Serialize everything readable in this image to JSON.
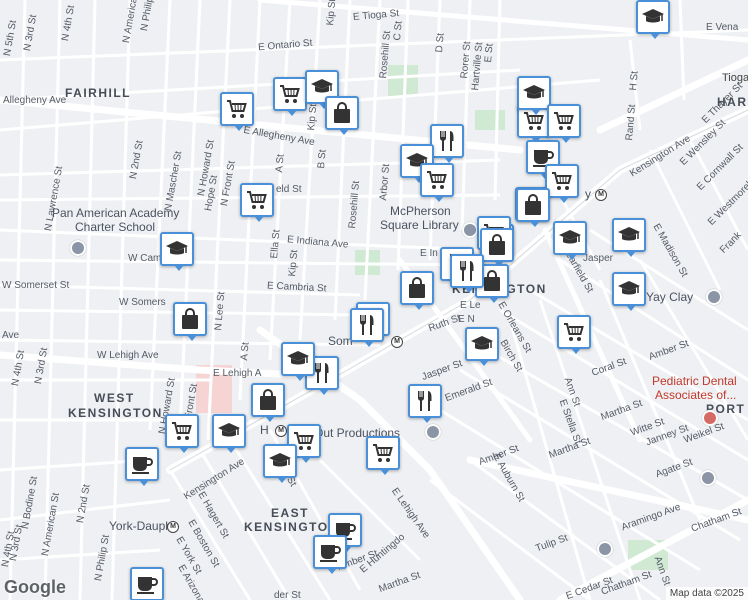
{
  "map": {
    "attribution": "Map data ©2025",
    "logo": "Google",
    "neighborhoods": [
      {
        "id": "fairhill",
        "text": "FAIRHILL"
      },
      {
        "id": "harrowgate",
        "text": "HARR"
      },
      {
        "id": "west-kensington-1",
        "text": "WEST"
      },
      {
        "id": "west-kensington-2",
        "text": "KENSINGTON"
      },
      {
        "id": "kensington",
        "text": "KENSINGTON"
      },
      {
        "id": "east-kensington-1",
        "text": "EAST"
      },
      {
        "id": "east-kensington-2",
        "text": "KENSINGTON"
      },
      {
        "id": "port",
        "text": "PORT"
      }
    ],
    "places": [
      {
        "id": "pan-american-1",
        "text": "Pan American Academy",
        "style": "place"
      },
      {
        "id": "pan-american-2",
        "text": "Charter School",
        "style": "place"
      },
      {
        "id": "mcpherson-1",
        "text": "McPherson",
        "style": "place"
      },
      {
        "id": "mcpherson-2",
        "text": "Square Library",
        "style": "place"
      },
      {
        "id": "yay-clay",
        "text": "Yay Clay",
        "style": "place"
      },
      {
        "id": "pediatric-1",
        "text": "Pediatric Dental",
        "style": "red"
      },
      {
        "id": "pediatric-2",
        "text": "Associates of...",
        "style": "red"
      },
      {
        "id": "out-productions",
        "text": "Out Productions",
        "style": "place"
      },
      {
        "id": "york-dauphin",
        "text": "York-Dauphi",
        "style": "place"
      },
      {
        "id": "somerset-station",
        "text": "Som",
        "style": "place"
      },
      {
        "id": "huntingdon-station",
        "text": "H",
        "style": "place"
      },
      {
        "id": "allegheny-station",
        "text": "y",
        "style": "place"
      },
      {
        "id": "tioga-label",
        "text": "Tioga",
        "style": "big"
      }
    ],
    "streets": [
      {
        "id": "n-5th",
        "text": "N 5th St"
      },
      {
        "id": "n-4th-top",
        "text": "N 4th St"
      },
      {
        "id": "n-3rd-top",
        "text": "N 3rd St"
      },
      {
        "id": "n-2nd-top",
        "text": "N 2nd St"
      },
      {
        "id": "n-american-top",
        "text": "N American St"
      },
      {
        "id": "n-philip-top",
        "text": "N Philip St"
      },
      {
        "id": "n-mascher",
        "text": "N Mascher St"
      },
      {
        "id": "n-howard-top",
        "text": "N Howard St"
      },
      {
        "id": "hope",
        "text": "Hope St"
      },
      {
        "id": "n-front-top",
        "text": "N Front St"
      },
      {
        "id": "n-lawrence",
        "text": "N Lawrence St"
      },
      {
        "id": "e-tioga",
        "text": "E Tioga St"
      },
      {
        "id": "e-ontario",
        "text": "E Ontario St"
      },
      {
        "id": "e-allegheny",
        "text": "E Allegheny Ave"
      },
      {
        "id": "w-allegheny",
        "text": "Allegheny Ave"
      },
      {
        "id": "e-indiana",
        "text": "E Indiana Ave"
      },
      {
        "id": "e-cambria",
        "text": "E Cambria St"
      },
      {
        "id": "w-cambria",
        "text": "W Cambria St"
      },
      {
        "id": "w-somerset",
        "text": "W Somerset St"
      },
      {
        "id": "w-somerset-2",
        "text": "W Somers"
      },
      {
        "id": "w-lehigh",
        "text": "W Lehigh Ave"
      },
      {
        "id": "e-lehigh",
        "text": "E Lehigh A"
      },
      {
        "id": "e-lehigh-2",
        "text": "E Lehigh Ave"
      },
      {
        "id": "w-ave-left",
        "text": "Ave"
      },
      {
        "id": "kensington-ave",
        "text": "Kensington Ave"
      },
      {
        "id": "kensington-ave-ne",
        "text": "Kensington Ave"
      },
      {
        "id": "rosehill-1",
        "text": "Rosehill St"
      },
      {
        "id": "rosehill-2",
        "text": "Rosehill St"
      },
      {
        "id": "arbor",
        "text": "Arbor St"
      },
      {
        "id": "c-st",
        "text": "C St"
      },
      {
        "id": "d-st",
        "text": "D St"
      },
      {
        "id": "b-st",
        "text": "B St"
      },
      {
        "id": "kip-1",
        "text": "Kip St"
      },
      {
        "id": "kip-2",
        "text": "Kip St"
      },
      {
        "id": "kip-3",
        "text": "Kip St"
      },
      {
        "id": "ella",
        "text": "Ella St"
      },
      {
        "id": "a-st-1",
        "text": "A St"
      },
      {
        "id": "a-st-2",
        "text": "A St"
      },
      {
        "id": "n-lee",
        "text": "N Lee St"
      },
      {
        "id": "rorer",
        "text": "Rorer St"
      },
      {
        "id": "hartville",
        "text": "Hartville St"
      },
      {
        "id": "e-st",
        "text": "E St"
      },
      {
        "id": "h-st",
        "text": "H St"
      },
      {
        "id": "rand",
        "text": "Rand St"
      },
      {
        "id": "e-thayer",
        "text": "E Thayer St"
      },
      {
        "id": "e-wensley",
        "text": "E Wensley St"
      },
      {
        "id": "e-cornwall",
        "text": "E Cornwall St"
      },
      {
        "id": "e-westmoreland",
        "text": "E Westmoreland St"
      },
      {
        "id": "e-madison",
        "text": "E Madison St"
      },
      {
        "id": "frankford",
        "text": "Frank"
      },
      {
        "id": "jasper-1",
        "text": "Jasper"
      },
      {
        "id": "jasper-2",
        "text": "Jasper St"
      },
      {
        "id": "clearfield",
        "text": "Clearfield St"
      },
      {
        "id": "ruth",
        "text": "Ruth St"
      },
      {
        "id": "e-orleans",
        "text": "E Orleans St"
      },
      {
        "id": "birch",
        "text": "Birch St"
      },
      {
        "id": "emerald",
        "text": "Emerald St"
      },
      {
        "id": "amber-1",
        "text": "Amber St"
      },
      {
        "id": "amber-2",
        "text": "Amber St"
      },
      {
        "id": "amber-3",
        "text": "Amber St"
      },
      {
        "id": "coral",
        "text": "Coral St"
      },
      {
        "id": "ann",
        "text": "Ann St"
      },
      {
        "id": "ann-2",
        "text": "Ann St"
      },
      {
        "id": "e-stella",
        "text": "E Stella St"
      },
      {
        "id": "martha-1",
        "text": "Martha St"
      },
      {
        "id": "martha-2",
        "text": "Martha St"
      },
      {
        "id": "martha-3",
        "text": "Martha St"
      },
      {
        "id": "witte",
        "text": "Witte St"
      },
      {
        "id": "janney",
        "text": "Janney St"
      },
      {
        "id": "weikel",
        "text": "Weikel St"
      },
      {
        "id": "agate",
        "text": "Agate St"
      },
      {
        "id": "e-auburn",
        "text": "E Auburn St"
      },
      {
        "id": "aramingo",
        "text": "Aramingo Ave"
      },
      {
        "id": "tulip",
        "text": "Tulip St"
      },
      {
        "id": "chatham-1",
        "text": "Chatham St"
      },
      {
        "id": "chatham-2",
        "text": "Chatham St"
      },
      {
        "id": "e-cedar",
        "text": "E Cedar St"
      },
      {
        "id": "e-huntingdon",
        "text": "E Huntingdo"
      },
      {
        "id": "e-hagert",
        "text": "E Hagert St"
      },
      {
        "id": "e-boston",
        "text": "E Boston St"
      },
      {
        "id": "e-york",
        "text": "E York St"
      },
      {
        "id": "e-arizona",
        "text": "E Arizona"
      },
      {
        "id": "n-bodine",
        "text": "N Bodine St"
      },
      {
        "id": "n-american-bot",
        "text": "N American St"
      },
      {
        "id": "n-2nd-bot",
        "text": "N 2nd St"
      },
      {
        "id": "n-philip-bot",
        "text": "N Philip St"
      },
      {
        "id": "n-3rd-bot",
        "text": "N 3rd St"
      },
      {
        "id": "n-4th-bot",
        "text": "N 4th St"
      },
      {
        "id": "n-3rd-mid",
        "text": "N 3rd St"
      },
      {
        "id": "n-4th-mid",
        "text": "N 4th St"
      },
      {
        "id": "n-howard-bot",
        "text": "N Howard St"
      },
      {
        "id": "front-bot",
        "text": "Front St"
      },
      {
        "id": "e-venango",
        "text": "E Vena"
      },
      {
        "id": "field",
        "text": "eld St"
      },
      {
        "id": "ard-st",
        "text": "ard St"
      },
      {
        "id": "der-st",
        "text": "der St"
      },
      {
        "id": "e-le-st",
        "text": "E Le"
      },
      {
        "id": "e-n-st",
        "text": "E N"
      },
      {
        "id": "e-in",
        "text": "E In"
      }
    ],
    "markers": [
      {
        "id": "m1",
        "icon": "cart"
      },
      {
        "id": "m2",
        "icon": "cart"
      },
      {
        "id": "m3",
        "icon": "school"
      },
      {
        "id": "m4",
        "icon": "bag"
      },
      {
        "id": "m5",
        "icon": "cart"
      },
      {
        "id": "m6",
        "icon": "school"
      },
      {
        "id": "m7",
        "icon": "bag"
      },
      {
        "id": "m8",
        "icon": "cart"
      },
      {
        "id": "m9",
        "icon": "school"
      },
      {
        "id": "m10",
        "icon": "cart"
      },
      {
        "id": "m11",
        "icon": "restaurant"
      },
      {
        "id": "m12",
        "icon": "school"
      },
      {
        "id": "m13",
        "icon": "cart"
      },
      {
        "id": "m14",
        "icon": "coffee"
      },
      {
        "id": "m15",
        "icon": "school"
      },
      {
        "id": "m16",
        "icon": "cart"
      },
      {
        "id": "m17",
        "icon": "bag"
      },
      {
        "id": "m18",
        "icon": "bag"
      },
      {
        "id": "m19",
        "icon": "cart"
      },
      {
        "id": "m20",
        "icon": "bag"
      },
      {
        "id": "m21",
        "icon": "school"
      },
      {
        "id": "m22",
        "icon": "school"
      },
      {
        "id": "m23",
        "icon": "bag"
      },
      {
        "id": "m24",
        "icon": "restaurant"
      },
      {
        "id": "m25",
        "icon": "bag"
      },
      {
        "id": "m26",
        "icon": "restaurant"
      },
      {
        "id": "m27",
        "icon": "school"
      },
      {
        "id": "m28",
        "icon": "cart"
      },
      {
        "id": "m29",
        "icon": "school"
      },
      {
        "id": "m30",
        "icon": "restaurant"
      },
      {
        "id": "m31",
        "icon": "restaurant"
      },
      {
        "id": "m32",
        "icon": "restaurant"
      },
      {
        "id": "m33",
        "icon": "bag"
      },
      {
        "id": "m34",
        "icon": "cart"
      },
      {
        "id": "m35",
        "icon": "school"
      },
      {
        "id": "m36",
        "icon": "cart"
      },
      {
        "id": "m37",
        "icon": "school"
      },
      {
        "id": "m38",
        "icon": "restaurant"
      },
      {
        "id": "m39",
        "icon": "cart"
      },
      {
        "id": "m40",
        "icon": "coffee"
      },
      {
        "id": "m41",
        "icon": "coffee"
      },
      {
        "id": "m42",
        "icon": "coffee"
      },
      {
        "id": "m43",
        "icon": "coffee"
      },
      {
        "id": "m44",
        "icon": "school"
      },
      {
        "id": "m45",
        "icon": "school"
      }
    ]
  }
}
